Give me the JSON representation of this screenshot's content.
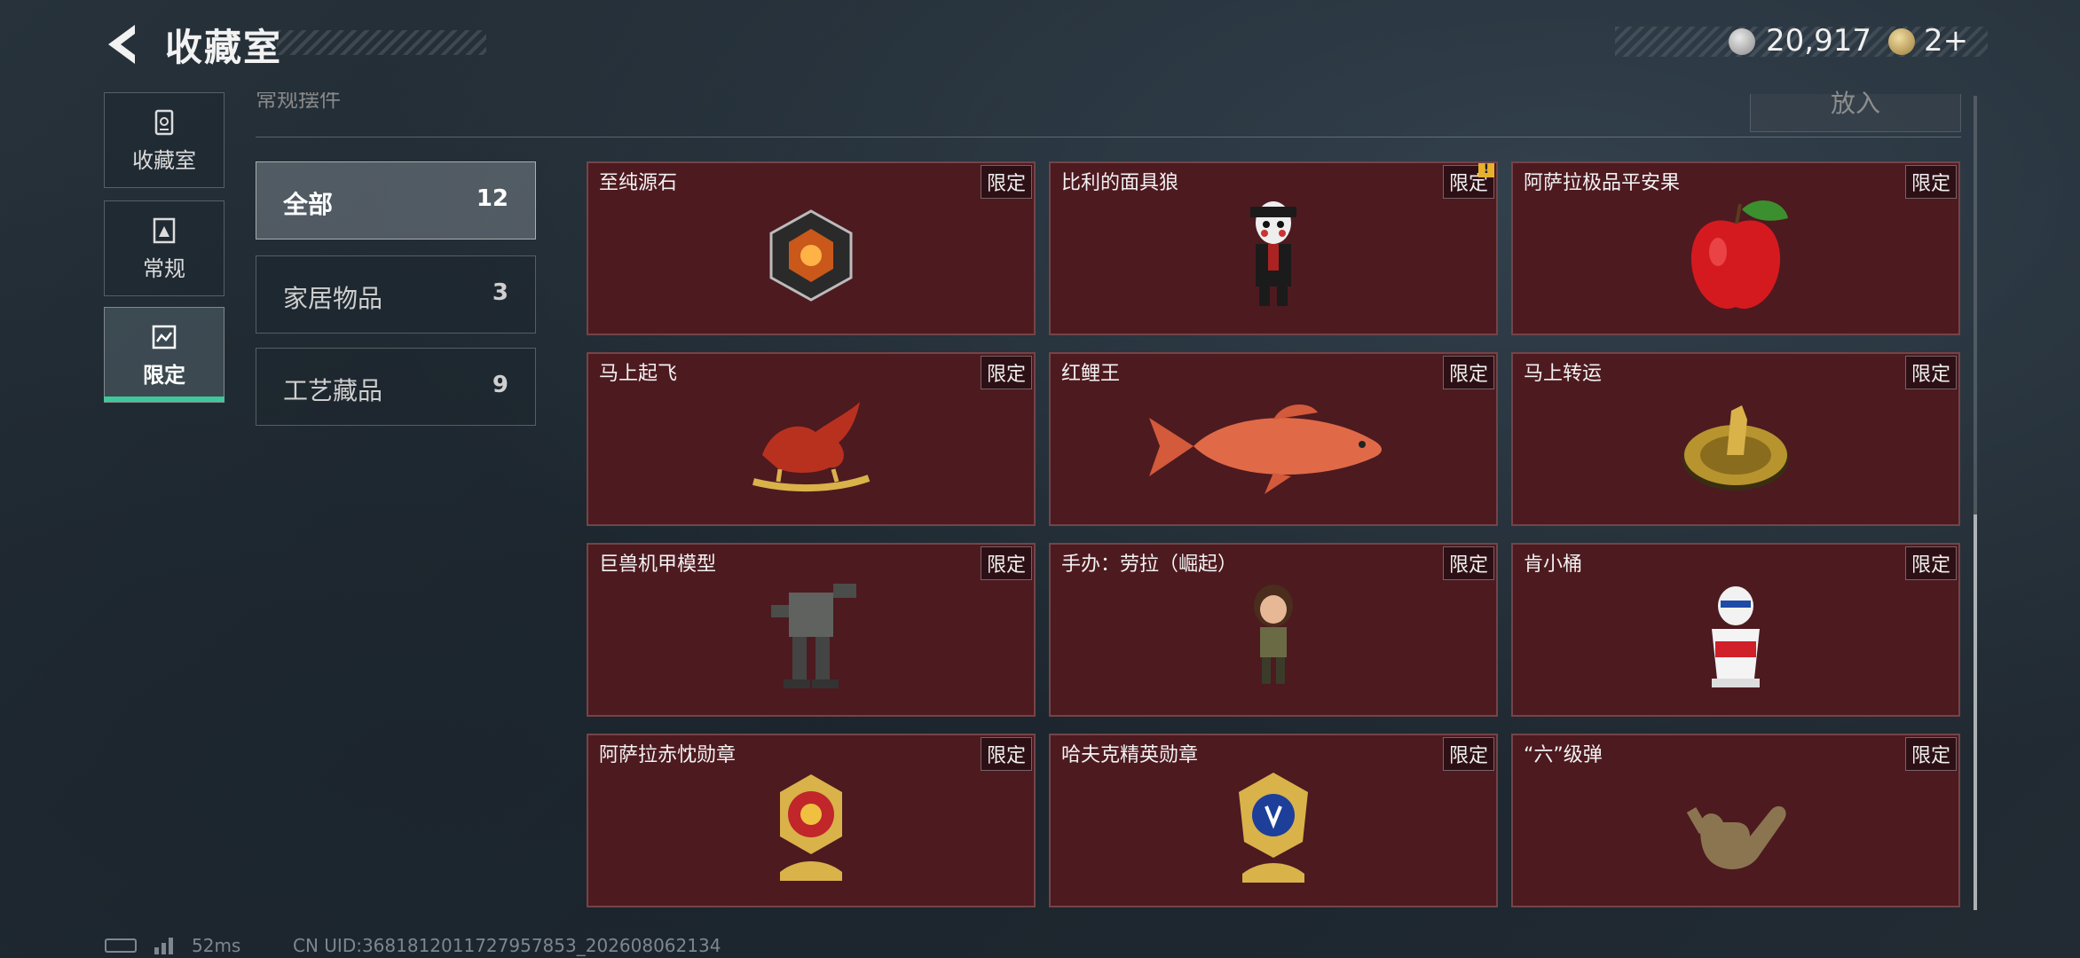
{
  "header": {
    "title": "收藏室",
    "coins": "20,917",
    "tickets": "2+"
  },
  "nav": {
    "tabs": [
      {
        "label": "收藏室",
        "icon": "collection-icon"
      },
      {
        "label": "常规",
        "icon": "regular-icon"
      },
      {
        "label": "限定",
        "icon": "limited-icon",
        "active": true
      }
    ]
  },
  "content": {
    "section_header": "常规摆件",
    "put_in_label": "放入"
  },
  "categories": [
    {
      "label": "全部",
      "count": "12",
      "active": true
    },
    {
      "label": "家居物品",
      "count": "3"
    },
    {
      "label": "工艺藏品",
      "count": "9"
    }
  ],
  "items": [
    {
      "name": "至纯源石",
      "tag": "限定"
    },
    {
      "name": "比利的面具狼",
      "tag": "限定",
      "alert": "!"
    },
    {
      "name": "阿萨拉极品平安果",
      "tag": "限定"
    },
    {
      "name": "马上起飞",
      "tag": "限定"
    },
    {
      "name": "红鲤王",
      "tag": "限定"
    },
    {
      "name": "马上转运",
      "tag": "限定"
    },
    {
      "name": "巨兽机甲模型",
      "tag": "限定"
    },
    {
      "name": "手办：劳拉（崛起）",
      "tag": "限定"
    },
    {
      "name": "肯小桶",
      "tag": "限定"
    },
    {
      "name": "阿萨拉赤忱勋章",
      "tag": "限定"
    },
    {
      "name": "哈夫克精英勋章",
      "tag": "限定"
    },
    {
      "name": "“六”级弹",
      "tag": "限定"
    }
  ],
  "status": {
    "ping": "52ms",
    "uid": "CN UID:3681812011727957853_202608062134"
  },
  "colors": {
    "accent": "#3fc89a",
    "card_bg": "#4d1a20"
  }
}
